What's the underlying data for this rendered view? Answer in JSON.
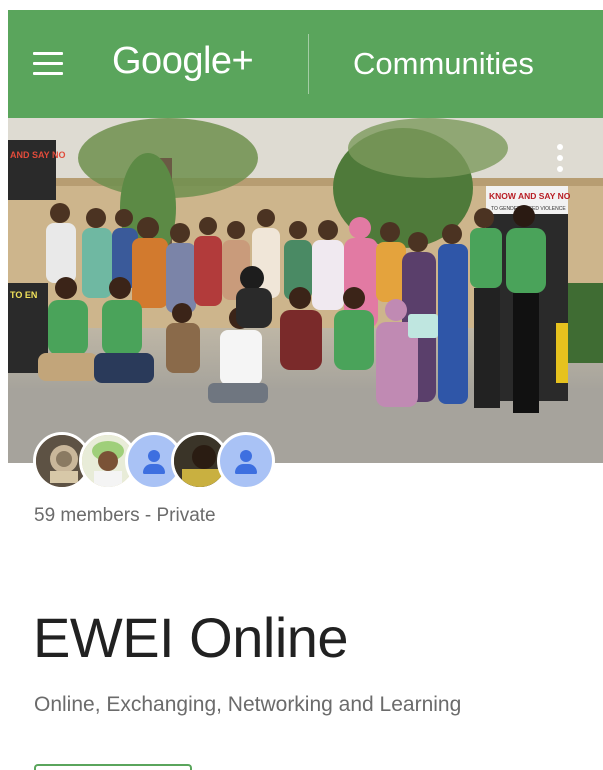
{
  "app_bar": {
    "brand": "Google+",
    "section": "Communities",
    "color": "#5aa55c"
  },
  "icons": {
    "menu": "hamburger-menu-icon",
    "overflow": "more-vert-icon",
    "member_placeholder": "person-icon"
  },
  "community": {
    "members_text": "59 members - Private",
    "name": "EWEI Online",
    "tagline": "Online, Exchanging, Networking and Learning"
  },
  "cover_banners": {
    "left": "AND SAY NO",
    "right_title": "KNOW AND SAY NO",
    "right_sub": "TO GENDER BASED VIOLENCE",
    "left_lower": "TO EN"
  },
  "member_avatars": [
    {
      "type": "photo",
      "tone": "#7a6248"
    },
    {
      "type": "photo",
      "tone": "#d8c28a"
    },
    {
      "type": "placeholder"
    },
    {
      "type": "photo",
      "tone": "#4a4030"
    },
    {
      "type": "placeholder"
    }
  ]
}
